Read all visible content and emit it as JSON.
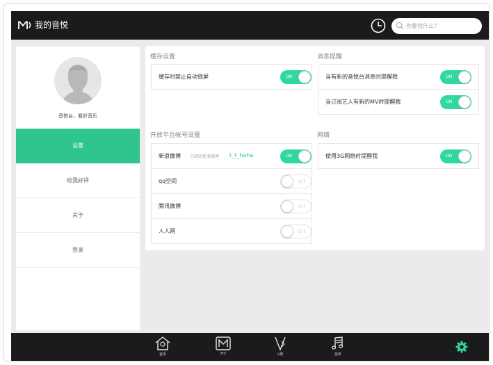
{
  "header": {
    "title": "我的音悦",
    "search_placeholder": "你要找什么？"
  },
  "sidebar": {
    "slogan": "音悦台，看好音乐",
    "items": [
      {
        "label": "设置",
        "active": true
      },
      {
        "label": "给我好评",
        "active": false
      },
      {
        "label": "关于",
        "active": false
      },
      {
        "label": "登录",
        "active": false
      }
    ]
  },
  "sections": {
    "cache": {
      "title": "缓存设置",
      "rows": [
        {
          "label": "缓存时禁止自动锁屏",
          "toggle": "ON"
        }
      ]
    },
    "platform": {
      "title": "开放平台帐号设置",
      "rows": [
        {
          "label": "新浪微博",
          "sub": "已绑定新浪微博",
          "link": "t_t_haha",
          "toggle": "ON"
        },
        {
          "label": "qq空间",
          "toggle": "OFF"
        },
        {
          "label": "腾讯微博",
          "toggle": "OFF"
        },
        {
          "label": "人人网",
          "toggle": "OFF"
        }
      ]
    },
    "notify": {
      "title": "消息提醒",
      "rows": [
        {
          "label": "当有新的音悦台消息时提醒我",
          "toggle": "ON"
        },
        {
          "label": "当订阅艺人有新的MV时提醒我",
          "toggle": "ON"
        }
      ]
    },
    "network": {
      "title": "网络",
      "rows": [
        {
          "label": "使用3G网络时提醒我",
          "toggle": "ON"
        }
      ]
    }
  },
  "bottom_nav": [
    {
      "label": "首页",
      "icon": "home-icon"
    },
    {
      "label": "MV",
      "icon": "mv-icon"
    },
    {
      "label": "V榜",
      "icon": "vchart-icon"
    },
    {
      "label": "悦单",
      "icon": "playlist-icon"
    }
  ],
  "colors": {
    "accent": "#2fc58c",
    "toggle_on": "#2fd89b",
    "bar": "#1b1b1b"
  }
}
